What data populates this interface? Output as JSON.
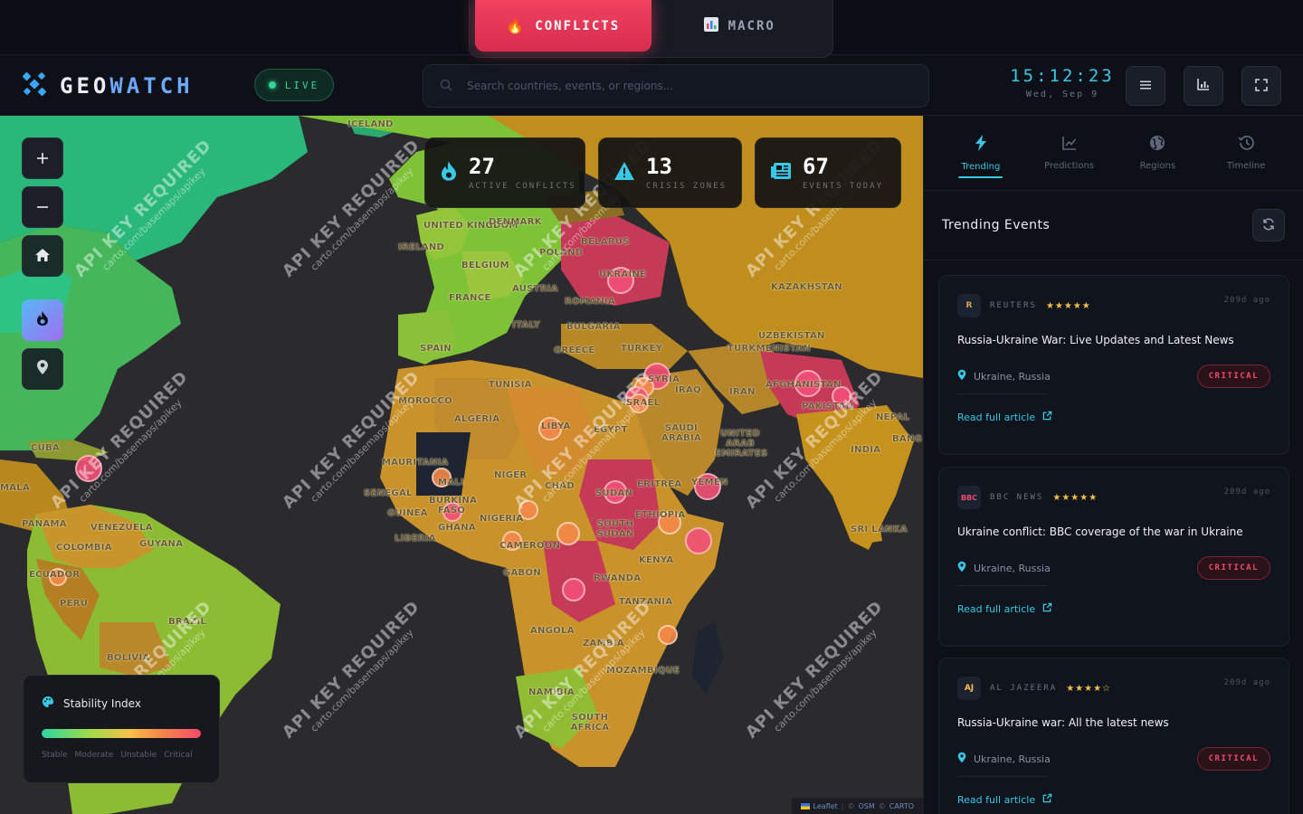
{
  "mode_tabs": [
    {
      "label": "CONFLICTS",
      "icon": "fire-icon",
      "active": true
    },
    {
      "label": "MACRO",
      "icon": "bar-chart-icon",
      "active": false
    }
  ],
  "header": {
    "logo_part1": "GEO",
    "logo_part2": "WATCH",
    "live_label": "LIVE",
    "search_placeholder": "Search countries, events, or regions...",
    "clock_time": "15:12:23",
    "clock_date": "Wed, Sep 9"
  },
  "stats": [
    {
      "value": "27",
      "label": "ACTIVE CONFLICTS",
      "icon": "flame-icon",
      "color": "#38c9e6"
    },
    {
      "value": "13",
      "label": "CRISIS ZONES",
      "icon": "warning-icon",
      "color": "#38c9e6"
    },
    {
      "value": "67",
      "label": "EVENTS TODAY",
      "icon": "newspaper-icon",
      "color": "#38c9e6"
    }
  ],
  "map": {
    "watermark_line1": "API KEY REQUIRED",
    "watermark_line2": "carto.com/basemaps/apikey",
    "labels": [
      "ICELAND",
      "UNITED KINGDOM",
      "IRELAND",
      "DENMARK",
      "BELARUS",
      "POLAND",
      "UKRAINE",
      "BELGIUM",
      "AUSTRIA",
      "FRANCE",
      "ROMANIA",
      "ITALY",
      "BULGARIA",
      "SPAIN",
      "GREECE",
      "TURKEY",
      "KAZAKHSTAN",
      "UZBEKISTAN",
      "TURKMENISTAN",
      "TUNISIA",
      "SYRIA",
      "IRAQ",
      "AFGHANISTAN",
      "MOROCCO",
      "ISRAEL",
      "IRAN",
      "PAKISTAN",
      "NEPAL",
      "ALGERIA",
      "LIBYA",
      "EGYPT",
      "SAUDI ARABIA",
      "UNITED ARAB EMIRATES",
      "INDIA",
      "MAURITANIA",
      "MALI",
      "NIGER",
      "CHAD",
      "SUDAN",
      "ERITREA",
      "YEMEN",
      "SENEGAL",
      "BURKINA FASO",
      "GUINEA",
      "NIGERIA",
      "ETHIOPIA",
      "SOUTH SUDAN",
      "GHANA",
      "LIBERIA",
      "CAMEROON",
      "KENYA",
      "GABON",
      "RWANDA",
      "TANZANIA",
      "ANGOLA",
      "ZAMBIA",
      "MOZAMBIQUE",
      "NAMIBIA",
      "SOUTH AFRICA",
      "SRI LANKA",
      "CUBA",
      "PANAMA",
      "VENEZUELA",
      "GUYANA",
      "COLOMBIA",
      "ECUADOR",
      "PERU",
      "BRAZIL",
      "BOLIVIA",
      "MALA",
      "BANG"
    ],
    "attribution_leaflet": "Leaflet",
    "attribution_osm": "OSM",
    "attribution_carto": "CARTO",
    "controls": [
      "zoom-in",
      "zoom-out",
      "home",
      "heat-layer",
      "markers-layer"
    ]
  },
  "legend": {
    "title": "Stability Index",
    "labels": [
      "Stable",
      "Moderate",
      "Unstable",
      "Critical"
    ]
  },
  "panel": {
    "tabs": [
      {
        "label": "Trending",
        "icon": "bolt-icon",
        "active": true
      },
      {
        "label": "Predictions",
        "icon": "trend-chart-icon",
        "active": false
      },
      {
        "label": "Regions",
        "icon": "globe-icon",
        "active": false
      },
      {
        "label": "Timeline",
        "icon": "history-icon",
        "active": false
      }
    ],
    "title": "Trending Events",
    "events": [
      {
        "badge": "R",
        "source": "REUTERS",
        "stars": "★★★★★",
        "ago": "209d ago",
        "title": "Russia-Ukraine War: Live Updates and Latest News",
        "location": "Ukraine, Russia",
        "severity": "CRITICAL",
        "link": "Read full article",
        "badge_color": "#d5a24a"
      },
      {
        "badge": "BBC",
        "source": "BBC NEWS",
        "stars": "★★★★★",
        "ago": "209d ago",
        "title": "Ukraine conflict: BBC coverage of the war in Ukraine",
        "location": "Ukraine, Russia",
        "severity": "CRITICAL",
        "link": "Read full article",
        "badge_color": "#f04b6a"
      },
      {
        "badge": "AJ",
        "source": "AL JAZEERA",
        "stars": "★★★★☆",
        "ago": "209d ago",
        "title": "Russia-Ukraine war: All the latest news",
        "location": "Ukraine, Russia",
        "severity": "CRITICAL",
        "link": "Read full article",
        "badge_color": "#f5c04a"
      }
    ]
  }
}
